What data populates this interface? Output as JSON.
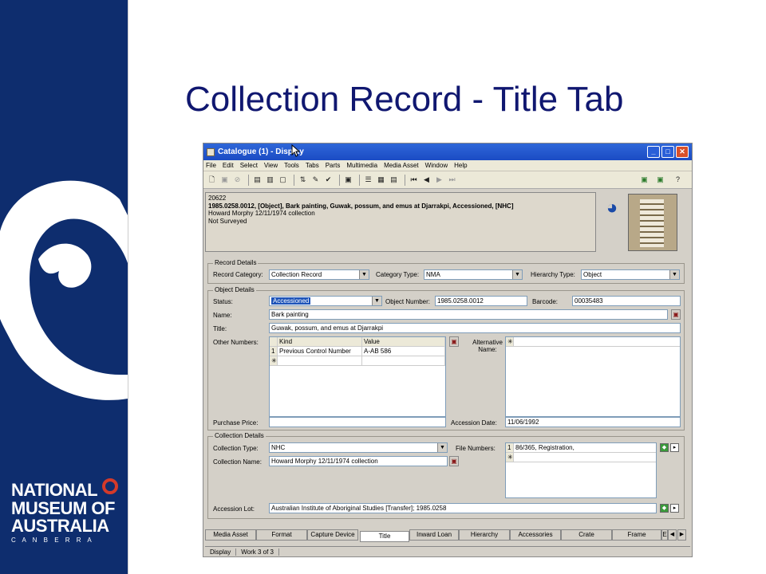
{
  "slide": {
    "title": "Collection Record - Title Tab"
  },
  "logo": {
    "line1": "NATIONAL",
    "line2": "MUSEUM OF",
    "line3": "AUSTRALIA",
    "line4": "C A N B E R R A"
  },
  "window": {
    "title": "Catalogue (1) - Display",
    "menu": [
      "File",
      "Edit",
      "Select",
      "View",
      "Tools",
      "Tabs",
      "Parts",
      "Multimedia",
      "Media Asset",
      "Window",
      "Help"
    ]
  },
  "summary": {
    "line1": "20622",
    "line2": "1985.0258.0012, [Object], Bark painting, Guwak, possum, and emus at Djarrakpi, Accessioned, [NHC]",
    "line3": "Howard Morphy 12/11/1974 collection",
    "line4": "Not Surveyed"
  },
  "record_details": {
    "group": "Record Details",
    "record_category_label": "Record Category:",
    "record_category": "Collection Record",
    "category_type_label": "Category Type:",
    "category_type": "NMA",
    "hierarchy_type_label": "Hierarchy Type:",
    "hierarchy_type": "Object"
  },
  "object_details": {
    "group": "Object Details",
    "status_label": "Status:",
    "status": "Accessioned",
    "object_number_label": "Object Number:",
    "object_number": "1985.0258.0012",
    "barcode_label": "Barcode:",
    "barcode": "00035483",
    "name_label": "Name:",
    "name": "Bark painting",
    "title_label": "Title:",
    "title": "Guwak, possum, and emus at Djarrakpi",
    "other_numbers_label": "Other Numbers:",
    "other_numbers_headers": [
      "Kind",
      "Value"
    ],
    "other_numbers_rows": [
      {
        "n": "1",
        "kind": "Previous Control Number",
        "value": "A-AB 586"
      }
    ],
    "alternative_name_label1": "Alternative",
    "alternative_name_label2": "Name:",
    "purchase_price_label": "Purchase Price:",
    "accession_date_label": "Accession Date:",
    "accession_date": "11/06/1992"
  },
  "collection_details": {
    "group": "Collection Details",
    "collection_type_label": "Collection Type:",
    "collection_type": "NHC",
    "collection_name_label": "Collection Name:",
    "collection_name": "Howard Morphy 12/11/1974 collection",
    "file_numbers_label": "File Numbers:",
    "file_numbers": [
      {
        "n": "1",
        "value": "86/365, Registration,"
      }
    ],
    "accession_lot_label": "Accession Lot:",
    "accession_lot": "Australian Institute of Aboriginal Studies [Transfer]; 1985.0258"
  },
  "tabs": [
    "Media Asset",
    "Format",
    "Capture Device",
    "Title",
    "Inward Loan",
    "Hierarchy",
    "Accessories",
    "Crate",
    "Frame",
    "E"
  ],
  "status_bar": {
    "mode": "Display",
    "work": "Work 3 of 3"
  }
}
